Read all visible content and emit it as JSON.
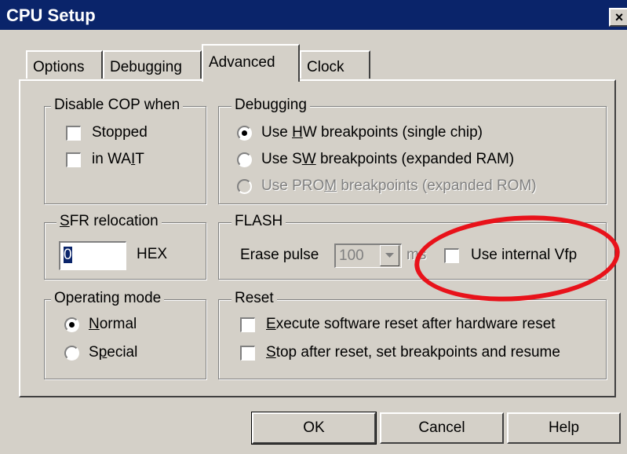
{
  "window": {
    "title": "CPU Setup",
    "close": "×"
  },
  "tabs": [
    {
      "label": "Options"
    },
    {
      "label": "Debugging"
    },
    {
      "label": "Advanced"
    },
    {
      "label": "Clock"
    }
  ],
  "disable_cop": {
    "legend": "Disable COP when",
    "stopped": "Stopped",
    "in_wait": {
      "pre": "in WA",
      "u": "I",
      "post": "T"
    }
  },
  "debugging": {
    "legend": "Debugging",
    "hw": {
      "pre": "Use ",
      "u": "H",
      "post": "W breakpoints (single chip)"
    },
    "sw": {
      "pre": "Use S",
      "u": "W",
      "post": " breakpoints (expanded RAM)"
    },
    "prom": {
      "pre": "Use PRO",
      "u": "M",
      "post": " breakpoints (expanded ROM)"
    }
  },
  "sfr": {
    "legend": {
      "u": "S",
      "post": "FR relocation"
    },
    "value": "0",
    "unit": "HEX"
  },
  "flash": {
    "legend": "FLASH",
    "erase_label": "Erase pulse",
    "erase_value": "100",
    "erase_unit": "ms",
    "vfp_label": "Use internal Vfp"
  },
  "operating_mode": {
    "legend": "Operating mode",
    "normal": {
      "u": "N",
      "post": "ormal"
    },
    "special": {
      "pre": "S",
      "u": "p",
      "post": "ecial"
    }
  },
  "reset": {
    "legend": "Reset",
    "execute": {
      "u": "E",
      "post": "xecute software reset after hardware reset"
    },
    "stop": {
      "u": "S",
      "post": "top after reset, set breakpoints and resume"
    }
  },
  "buttons": {
    "ok": "OK",
    "cancel": "Cancel",
    "help": "Help"
  },
  "colors": {
    "titlebar": "#0a246a",
    "face": "#d4d0c8",
    "annotation": "#e8121a"
  }
}
